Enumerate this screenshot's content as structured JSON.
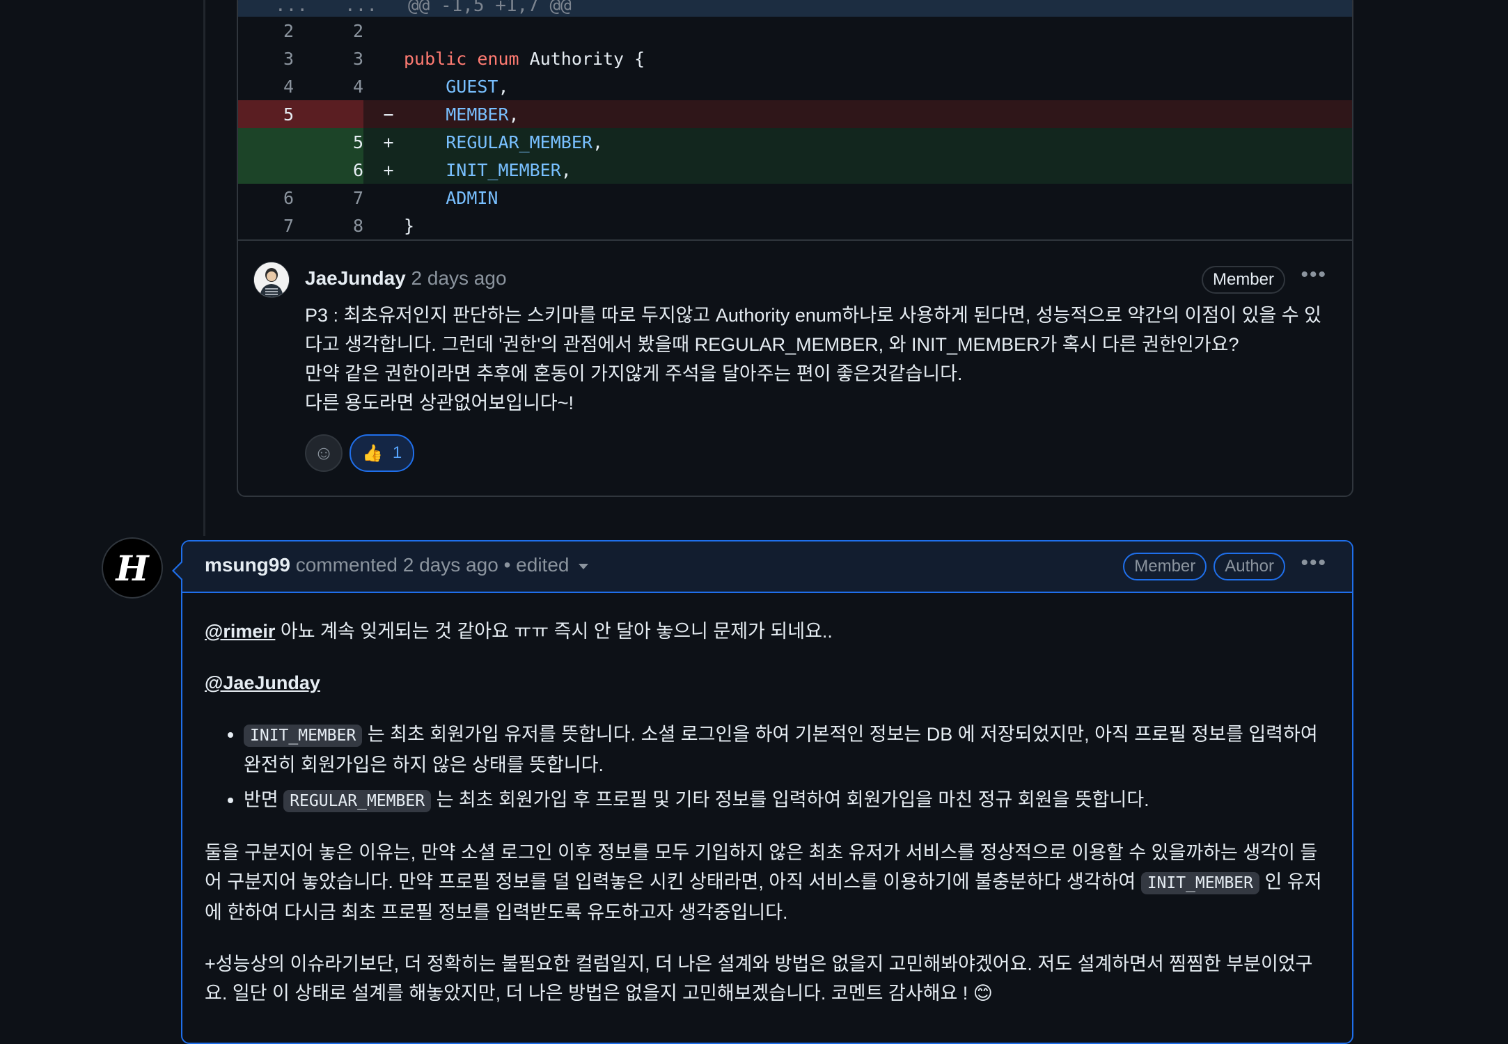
{
  "diff": {
    "hunk_header": {
      "old_ln": "...",
      "new_ln": "...",
      "text": "@@ -1,5 +1,7 @@"
    },
    "rows": [
      {
        "type": "ctx",
        "old": "2",
        "new": "2",
        "sign": "",
        "code": ""
      },
      {
        "type": "ctx",
        "old": "3",
        "new": "3",
        "sign": "",
        "code_parts": [
          {
            "t": "public",
            "c": "kw"
          },
          {
            "t": " "
          },
          {
            "t": "enum",
            "c": "kw"
          },
          {
            "t": " Authority {"
          }
        ]
      },
      {
        "type": "ctx",
        "old": "4",
        "new": "4",
        "sign": "",
        "code_parts": [
          {
            "t": "    "
          },
          {
            "t": "GUEST",
            "c": "const"
          },
          {
            "t": ","
          }
        ]
      },
      {
        "type": "del",
        "old": "5",
        "new": "",
        "sign": "−",
        "code_parts": [
          {
            "t": "    "
          },
          {
            "t": "MEMBER",
            "c": "const"
          },
          {
            "t": ","
          }
        ]
      },
      {
        "type": "add",
        "old": "",
        "new": "5",
        "sign": "+",
        "code_parts": [
          {
            "t": "    "
          },
          {
            "t": "REGULAR_MEMBER",
            "c": "const"
          },
          {
            "t": ","
          }
        ]
      },
      {
        "type": "add",
        "old": "",
        "new": "6",
        "sign": "+",
        "code_parts": [
          {
            "t": "    "
          },
          {
            "t": "INIT_MEMBER",
            "c": "const"
          },
          {
            "t": ","
          }
        ]
      },
      {
        "type": "ctx",
        "old": "6",
        "new": "7",
        "sign": "",
        "code_parts": [
          {
            "t": "    "
          },
          {
            "t": "ADMIN",
            "c": "const"
          }
        ]
      },
      {
        "type": "ctx",
        "old": "7",
        "new": "8",
        "sign": "",
        "code_parts": [
          {
            "t": "}"
          }
        ]
      }
    ]
  },
  "review_comment": {
    "author": "JaeJunday",
    "time": "2 days ago",
    "badge": "Member",
    "more": "•••",
    "lines": [
      "P3 : 최초유저인지 판단하는 스키마를 따로 두지않고 Authority enum하나로 사용하게 된다면, 성능적으로 약간의 이점이 있을 수 있",
      "다고 생각합니다. 그런데 '권한'의 관점에서 봤을때 REGULAR_MEMBER, 와 INIT_MEMBER가 혹시 다른 권한인가요?",
      "만약 같은 권한이라면 추후에 혼동이 가지않게 주석을 달아주는 편이 좋은것같습니다.",
      "다른 용도라면 상관없어보입니다~!"
    ],
    "reactions": {
      "smiley": "☺",
      "thumbs_emoji": "👍",
      "thumbs_count": "1"
    }
  },
  "main_comment": {
    "avatar_letter": "H",
    "author": "msung99",
    "action": "commented",
    "time": "2 days ago",
    "edited": "edited",
    "badges": [
      "Member",
      "Author"
    ],
    "more": "•••",
    "p1_mention": "@rimeir",
    "p1_text": " 아뇨 계속 잊게되는 것 같아요 ㅠㅠ 즉시 안 달아 놓으니 문제가 되네요..",
    "p2_mention": "@JaeJunday",
    "li1_code": "INIT_MEMBER",
    "li1_text": " 는 최초 회원가입 유저를 뜻합니다. 소셜 로그인을 하여 기본적인 정보는 DB 에 저장되었지만, 아직 프로필 정보를 입력하여 완전히 회원가입은 하지 않은 상태를 뜻합니다.",
    "li2_pre": "반면 ",
    "li2_code": "REGULAR_MEMBER",
    "li2_text": " 는 최초 회원가입 후 프로필 및 기타 정보를 입력하여 회원가입을 마친 정규 회원을 뜻합니다.",
    "p3_pre": "둘을 구분지어 놓은 이유는, 만약 소셜 로그인 이후 정보를 모두 기입하지 않은 최초 유저가 서비스를 정상적으로 이용할 수 있을까하는 생각이 들어 구분지어 놓았습니다. 만약 프로필 정보를 덜 입력놓은 시킨 상태라면, 아직 서비스를 이용하기에 불충분하다 생각하여 ",
    "p3_code": "INIT_MEMBER",
    "p3_post": " 인 유저에 한하여 다시금 최초 프로필 정보를 입력받도록 유도하고자 생각중입니다.",
    "p4_text": "+성능상의 이슈라기보단, 더 정확히는 불필요한 컬럼일지, 더 나은 설계와 방법은 없을지 고민해봐야겠어요. 저도 설계하면서 찜찜한 부분이었구요. 일단 이 상태로 설계를 해놓았지만, 더 나은 방법은 없을지 고민해보겠습니다. 코멘트 감사해요 ! 😊"
  }
}
